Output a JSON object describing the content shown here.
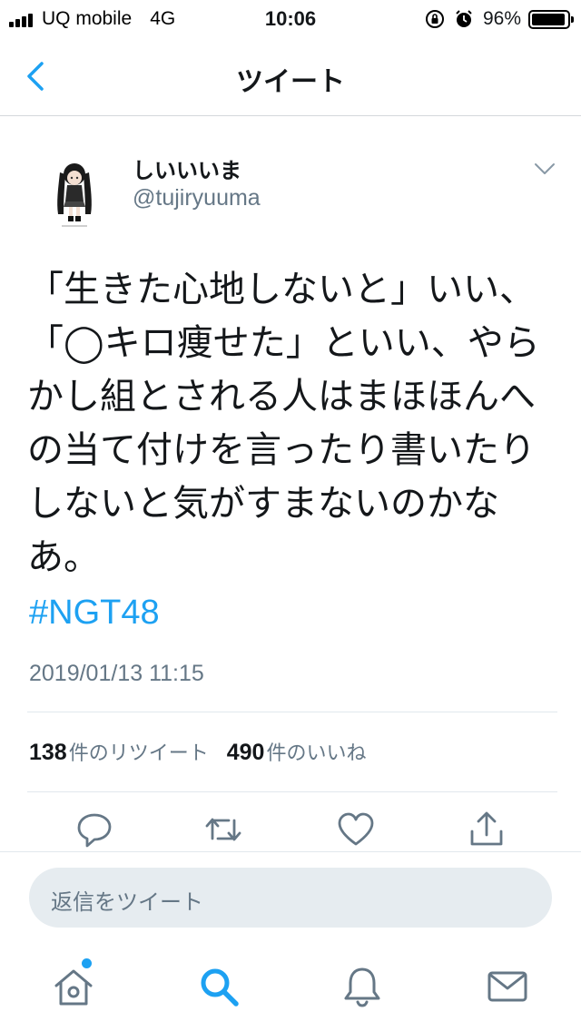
{
  "status_bar": {
    "carrier": "UQ mobile",
    "network": "4G",
    "time": "10:06",
    "battery_percent": "96%",
    "battery_level": 0.96
  },
  "nav": {
    "title": "ツイート",
    "back_icon": "chevron-left-icon"
  },
  "tweet": {
    "display_name": "しいいいま",
    "handle": "@tujiryuuma",
    "text": "「生きた心地しないと」いい、「◯キロ痩せた」といい、やらかし組とされる人はまほほんへの当て付けを言ったり書いたりしないと気がすまないのかなあ。",
    "hashtag": "#NGT48",
    "timestamp": "2019/01/13 11:15"
  },
  "stats": {
    "retweet_count": "138",
    "retweet_label": "件のリツイート",
    "like_count": "490",
    "like_label": "件のいいね"
  },
  "actions": {
    "reply_icon": "reply-icon",
    "retweet_icon": "retweet-icon",
    "like_icon": "heart-icon",
    "share_icon": "share-icon"
  },
  "reply": {
    "placeholder": "返信をツイート"
  },
  "tabs": {
    "home_icon": "home-icon",
    "search_icon": "search-icon",
    "notifications_icon": "bell-icon",
    "messages_icon": "mail-icon"
  },
  "colors": {
    "accent": "#1da1f2",
    "secondary_text": "#657786",
    "primary_text": "#14171a",
    "divider": "#e1e8ed"
  }
}
